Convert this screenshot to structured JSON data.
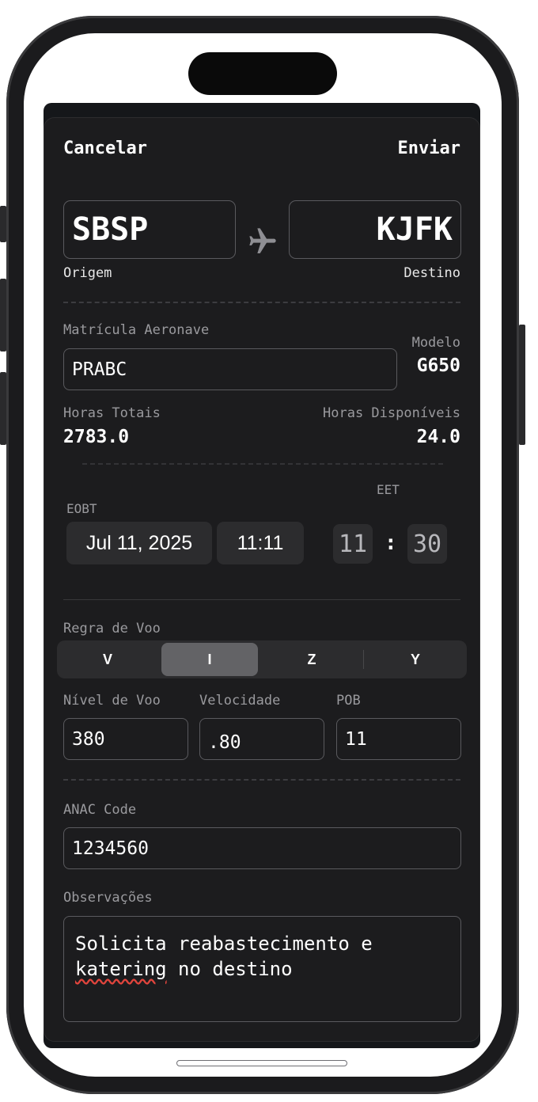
{
  "header": {
    "cancel_label": "Cancelar",
    "send_label": "Enviar"
  },
  "route": {
    "origin_code": "SBSP",
    "origin_label": "Origem",
    "destination_code": "KJFK",
    "destination_label": "Destino",
    "route_icon": "airplane-icon"
  },
  "aircraft": {
    "registration_label": "Matrícula Aeronave",
    "registration_value": "PRABC",
    "model_label": "Modelo",
    "model_value": "G650",
    "total_hours_label": "Horas Totais",
    "total_hours_value": "2783.0",
    "available_hours_label": "Horas Disponíveis",
    "available_hours_value": "24.0"
  },
  "schedule": {
    "eobt_label": "EOBT",
    "date_value": "Jul 11, 2025",
    "time_value": "11:11",
    "eet_label": "EET",
    "eet_hours": "11",
    "eet_separator": ":",
    "eet_minutes": "30"
  },
  "flight_rules": {
    "label": "Regra de Voo",
    "options": [
      "V",
      "I",
      "Z",
      "Y"
    ],
    "selected": "I"
  },
  "flight_params": {
    "level_label": "Nível de Voo",
    "level_value": "380",
    "speed_label": "Velocidade",
    "speed_value": ".80",
    "pob_label": "POB",
    "pob_value": "11"
  },
  "anac": {
    "label": "ANAC Code",
    "value": "1234560"
  },
  "notes": {
    "label": "Observações",
    "text_line1": "Solicita reabastecimento e",
    "text_misspelled": "katering",
    "text_rest": " no destino"
  },
  "colors": {
    "sheet_background": "#1c1c1e",
    "field_border": "#5a5a5e",
    "selected_segment": "#636366",
    "spellcheck_underline": "#e0443c"
  }
}
